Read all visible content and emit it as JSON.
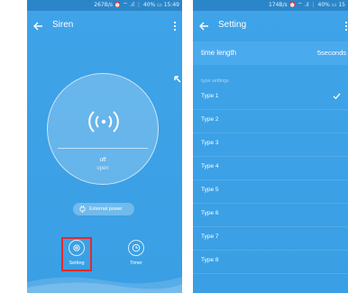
{
  "left_screen": {
    "status": "267B/s ⏰ ⌔ .ıl ⋮ 40% ▭ 15:49",
    "title": "Siren",
    "siren_state": "off",
    "siren_sub": "open",
    "power_label": "External power",
    "actions": [
      {
        "label": "Setting",
        "icon": "gear-icon",
        "highlighted": true
      },
      {
        "label": "Timer",
        "icon": "clock-icon",
        "highlighted": false
      }
    ],
    "colors": {
      "background": "#3aa0e6",
      "highlight": "#e32b2b"
    }
  },
  "right_screen": {
    "status": "174B/s ⏰ ⌔ .ıl ⋮ 40% ▭ 15",
    "title": "Setting",
    "time_length": {
      "label": "time length",
      "value": "5seconds"
    },
    "section_label": "type settings",
    "types": [
      {
        "label": "Type 1",
        "selected": true
      },
      {
        "label": "Type 2",
        "selected": false
      },
      {
        "label": "Type 3",
        "selected": false
      },
      {
        "label": "Type 4",
        "selected": false
      },
      {
        "label": "Type 5",
        "selected": false
      },
      {
        "label": "Type 6",
        "selected": false
      },
      {
        "label": "Type 7",
        "selected": false
      },
      {
        "label": "Type 8",
        "selected": false
      }
    ]
  }
}
